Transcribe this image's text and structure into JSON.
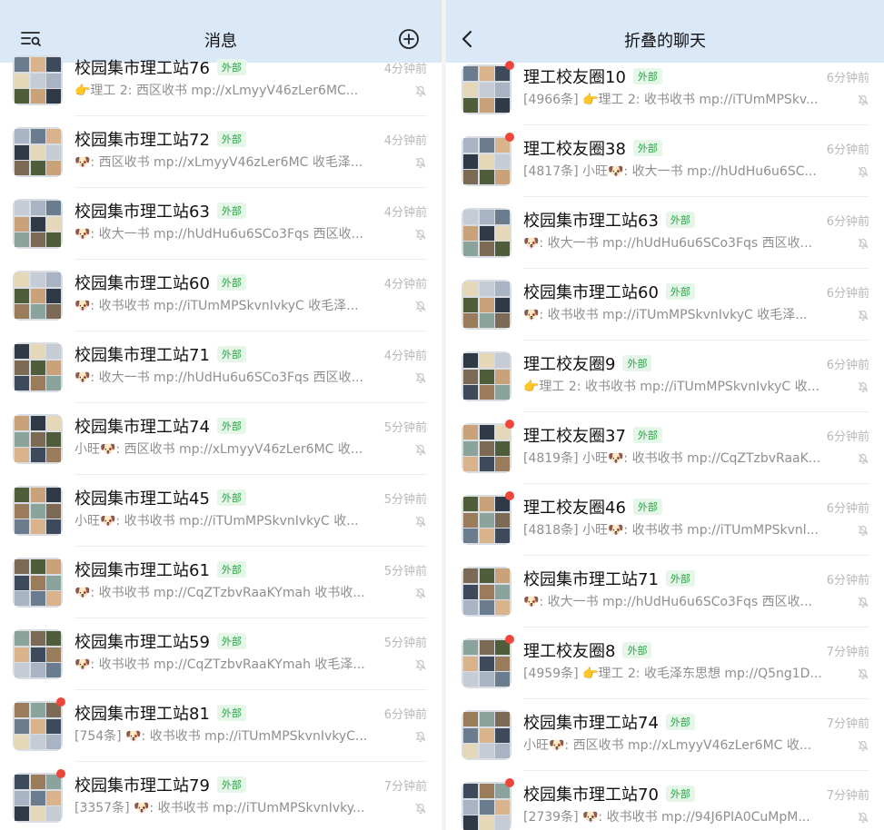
{
  "left": {
    "header": {
      "title": "消息",
      "left_icon": "filter-list-icon",
      "right_icon": "add-circle-icon"
    },
    "rows": [
      {
        "name": "校园集市理工站76",
        "tag": "外部",
        "time": "4分钟前",
        "preview": "👉理工 2: 西区收书 mp://xLmyyV46zLer6MC...",
        "badge": false
      },
      {
        "name": "校园集市理工站72",
        "tag": "外部",
        "time": "4分钟前",
        "preview": "🐶: 西区收书 mp://xLmyyV46zLer6MC 收毛泽...",
        "badge": false
      },
      {
        "name": "校园集市理工站63",
        "tag": "外部",
        "time": "4分钟前",
        "preview": "🐶: 收大一书 mp://hUdHu6u6SCo3Fqs 西区收...",
        "badge": false
      },
      {
        "name": "校园集市理工站60",
        "tag": "外部",
        "time": "4分钟前",
        "preview": "🐶: 收书收书 mp://iTUmMPSkvnIvkyC 收毛泽...",
        "badge": false
      },
      {
        "name": "校园集市理工站71",
        "tag": "外部",
        "time": "4分钟前",
        "preview": "🐶: 收大一书 mp://hUdHu6u6SCo3Fqs 西区收...",
        "badge": false
      },
      {
        "name": "校园集市理工站74",
        "tag": "外部",
        "time": "5分钟前",
        "preview": "小旺🐶: 西区收书 mp://xLmyyV46zLer6MC 收...",
        "badge": false
      },
      {
        "name": "校园集市理工站45",
        "tag": "外部",
        "time": "5分钟前",
        "preview": "小旺🐶: 收书收书 mp://iTUmMPSkvnIvkyC 收...",
        "badge": false
      },
      {
        "name": "校园集市理工站61",
        "tag": "外部",
        "time": "5分钟前",
        "preview": "🐶: 收书收书 mp://CqZTzbvRaaKYmah 收书收...",
        "badge": false
      },
      {
        "name": "校园集市理工站59",
        "tag": "外部",
        "time": "5分钟前",
        "preview": "🐶: 收书收书 mp://CqZTzbvRaaKYmah 收毛泽...",
        "badge": false
      },
      {
        "name": "校园集市理工站81",
        "tag": "外部",
        "time": "6分钟前",
        "preview": "[754条] 🐶: 收书收书 mp://iTUmMPSkvnIvkyC...",
        "badge": true
      },
      {
        "name": "校园集市理工站79",
        "tag": "外部",
        "time": "7分钟前",
        "preview": "[3357条] 🐶: 收书收书 mp://iTUmMPSkvnIvky...",
        "badge": true
      }
    ]
  },
  "right": {
    "header": {
      "title": "折叠的聊天",
      "left_icon": "back-chevron-icon"
    },
    "rows": [
      {
        "name": "理工校友圈10",
        "tag": "外部",
        "time": "6分钟前",
        "preview": "[4966条] 👉理工 2: 收书收书 mp://iTUmMPSkv...",
        "badge": true
      },
      {
        "name": "理工校友圈38",
        "tag": "外部",
        "time": "6分钟前",
        "preview": "[4817条] 小旺🐶: 收大一书 mp://hUdHu6u6SC...",
        "badge": true
      },
      {
        "name": "校园集市理工站63",
        "tag": "外部",
        "time": "6分钟前",
        "preview": "🐶: 收大一书 mp://hUdHu6u6SCo3Fqs 西区收...",
        "badge": false
      },
      {
        "name": "校园集市理工站60",
        "tag": "外部",
        "time": "6分钟前",
        "preview": "🐶: 收书收书 mp://iTUmMPSkvnIvkyC 收毛泽...",
        "badge": false
      },
      {
        "name": "理工校友圈9",
        "tag": "外部",
        "time": "6分钟前",
        "preview": "👉理工 2: 收书收书 mp://iTUmMPSkvnIvkyC 收...",
        "badge": false
      },
      {
        "name": "理工校友圈37",
        "tag": "外部",
        "time": "6分钟前",
        "preview": "[4819条] 小旺🐶: 收书收书 mp://CqZTzbvRaaK...",
        "badge": true
      },
      {
        "name": "理工校友圈46",
        "tag": "外部",
        "time": "6分钟前",
        "preview": "[4818条] 小旺🐶: 收书收书 mp://iTUmMPSkvnl...",
        "badge": true
      },
      {
        "name": "校园集市理工站71",
        "tag": "外部",
        "time": "6分钟前",
        "preview": "🐶: 收大一书 mp://hUdHu6u6SCo3Fqs 西区收...",
        "badge": false
      },
      {
        "name": "理工校友圈8",
        "tag": "外部",
        "time": "7分钟前",
        "preview": "[4959条] 👉理工 2: 收毛泽东思想 mp://Q5ng1D...",
        "badge": true
      },
      {
        "name": "校园集市理工站74",
        "tag": "外部",
        "time": "7分钟前",
        "preview": "小旺🐶: 西区收书 mp://xLmyyV46zLer6MC 收...",
        "badge": false
      },
      {
        "name": "校园集市理工站70",
        "tag": "外部",
        "time": "7分钟前",
        "preview": "[2739条] 🐶: 收书收书 mp://94J6PIA0CuMpM...",
        "badge": true
      }
    ]
  },
  "icons": {
    "mute": "mute-bell-icon"
  },
  "colors": {
    "header_bg": "#dbe8f8",
    "tag_text": "#2ba245",
    "tag_bg": "#e6f6e9",
    "badge": "#f0453a",
    "muted_text": "#8f8f8f"
  }
}
